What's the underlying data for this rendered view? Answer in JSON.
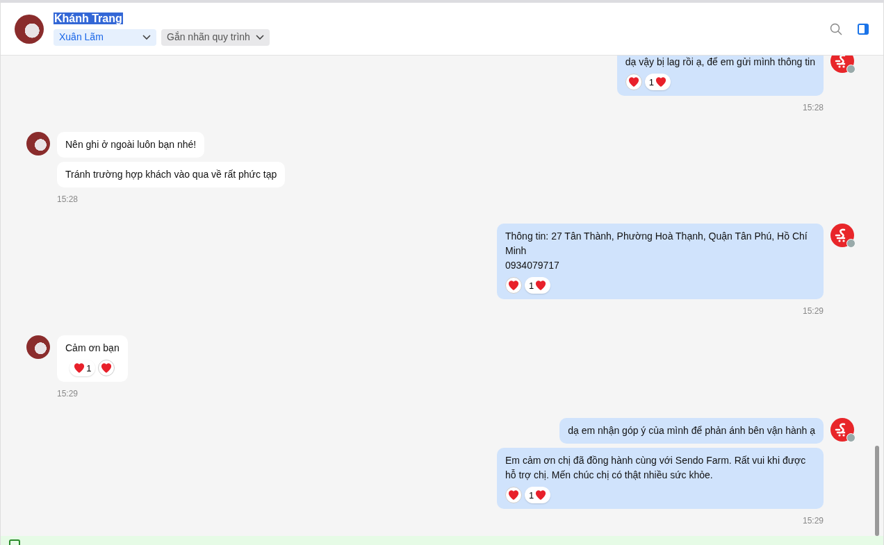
{
  "header": {
    "contact_name": "Khánh Trang",
    "name_selected": true,
    "assignee": "Xuân Lãm",
    "label_dropdown": "Gắn nhãn quy trình"
  },
  "messages": [
    {
      "kind": "outgoing",
      "bubbles": [
        {
          "text": "dạ vậy bị lag rồi ạ, để em gửi mình thông tin",
          "reaction_count": "1"
        }
      ],
      "time": "15:28"
    },
    {
      "kind": "incoming",
      "bubbles": [
        {
          "text": "Nên ghi ở ngoài luôn bạn nhé!"
        },
        {
          "text": "Tránh trường hợp khách vào qua về rất phức tạp"
        }
      ],
      "time": "15:28"
    },
    {
      "kind": "outgoing",
      "bubbles": [
        {
          "text": "Thông tin: 27 Tân Thành, Phường Hoà Thạnh, Quận Tân Phú, Hồ Chí Minh\n0934079717",
          "reaction_count": "1"
        }
      ],
      "time": "15:29"
    },
    {
      "kind": "incoming",
      "bubbles": [
        {
          "text": "Cảm ơn bạn",
          "reaction_count": "1"
        }
      ],
      "time": "15:29"
    },
    {
      "kind": "outgoing",
      "bubbles": [
        {
          "text": "dạ em nhận góp ý của mình để phản ánh bên vận hành ạ"
        },
        {
          "text": "Em cảm ơn chị đã đồng hành cùng với Sendo Farm. Rất vui khi được hỗ trợ chị. Mến chúc chị có thật nhiều sức khỏe.",
          "reaction_count": "1"
        }
      ],
      "time": "15:29"
    }
  ]
}
